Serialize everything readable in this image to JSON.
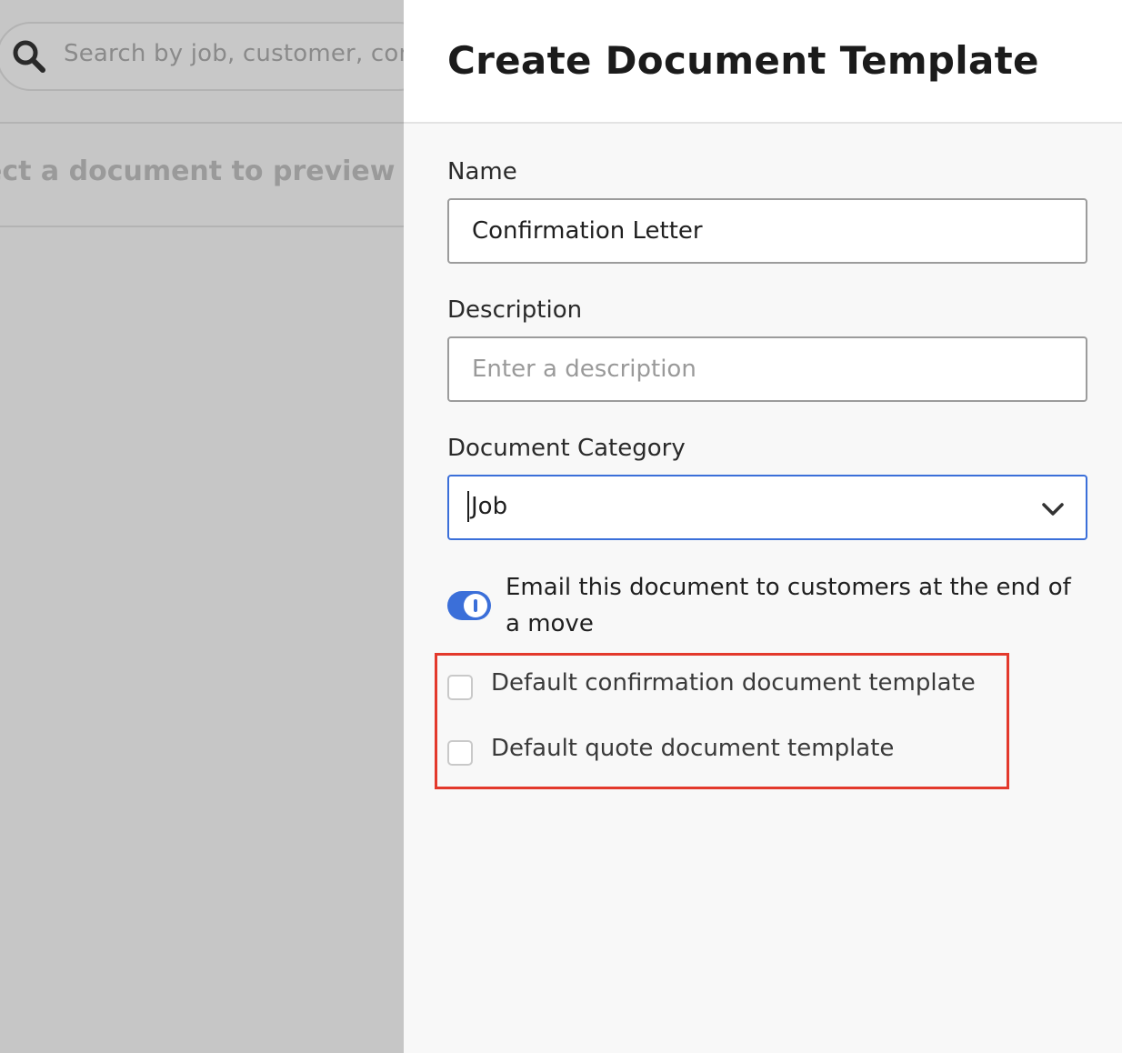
{
  "background": {
    "search": {
      "placeholder": "Search by job, customer, com"
    },
    "preview_hint": "ect a document to preview"
  },
  "drawer": {
    "title": "Create Document Template",
    "fields": {
      "name": {
        "label": "Name",
        "value": "Confirmation Letter"
      },
      "description": {
        "label": "Description",
        "value": "",
        "placeholder": "Enter a description"
      },
      "category": {
        "label": "Document Category",
        "selected": "Job"
      }
    },
    "email_toggle": {
      "label": "Email this document to customers at the end of a move",
      "on": true
    },
    "checkboxes": [
      {
        "label": "Default confirmation document template",
        "checked": false
      },
      {
        "label": "Default quote document template",
        "checked": false
      }
    ]
  },
  "colors": {
    "accent": "#3b6fd9",
    "highlight": "#e3392c",
    "backdrop": "#c6c6c6"
  }
}
